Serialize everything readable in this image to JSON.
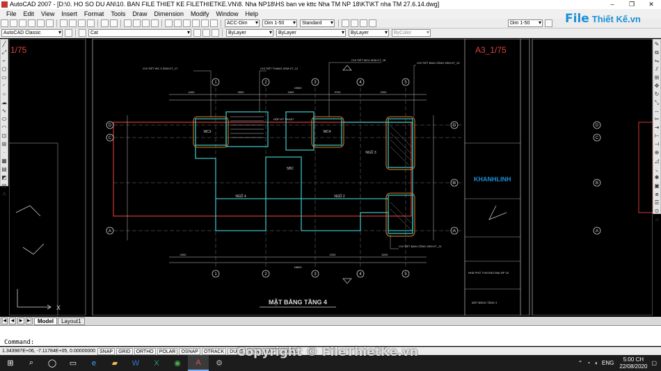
{
  "window": {
    "title": "AutoCAD 2007 - [D:\\0. HO SO DU AN\\10. BAN FILE THIET KE FILETHIETKE.VN\\8. Nha NP18\\HS ban ve kttc Nha TM NP 18\\KT\\KT nha TM 27.6.14.dwg]",
    "minimize": "–",
    "restore": "❐",
    "close": "✕"
  },
  "menu": [
    "File",
    "Edit",
    "View",
    "Insert",
    "Format",
    "Tools",
    "Draw",
    "Dimension",
    "Modify",
    "Window",
    "Help"
  ],
  "brand": {
    "logo": "File",
    "name": "Thiết Kế.vn"
  },
  "toolbar": {
    "text_style": "ACC-Dim",
    "dim_style": "Dim 1-50",
    "table_style": "Standard",
    "dim_style_right": "Dim 1-50",
    "workspace": "AutoCAD Classic",
    "layer": "Cat",
    "color": "ByLayer",
    "linetype": "ByLayer",
    "lineweight": "ByLayer",
    "plotstyle": "ByColor"
  },
  "drawing": {
    "sheet_left_scale": "1/75",
    "sheet_right_scale": "A3_1/75",
    "title": "MẶT BẰNG TẦNG 4",
    "grid_numbers": [
      "1",
      "2",
      "3",
      "4",
      "5"
    ],
    "grid_letters": [
      "D",
      "B",
      "C",
      "B",
      "A"
    ],
    "callouts": [
      "CHI TIẾT WC 3 XEM KT_17",
      "CHI TIẾT THANG XEM KT_12",
      "CHI TIẾT WC4 XEM KT_18",
      "CHI TIẾT BAN CÔNG XEM KT_22",
      "HỘP KỸ THUẬT",
      "CHI TIẾT BAN CÔNG XEM KT_21"
    ],
    "rooms": [
      "WC3",
      "WC4",
      "NGŨ 3",
      "NGŨ 4",
      "NGŨ 2",
      "SBC"
    ],
    "dims": [
      "4400",
      "3500",
      "3400",
      "3700",
      "2900",
      "19500",
      "18600",
      "2000",
      "2200",
      "5200"
    ],
    "title_block_logo": "KHANHLINH",
    "title_block_project": "NHÀ PHỐ THƯƠNG MẠI NP 18",
    "title_block_sheet": "MẶT BẰNG TẦNG 4"
  },
  "tabs": [
    "Model",
    "Layout1"
  ],
  "command": {
    "prompt": "Command:"
  },
  "status": {
    "coords": "1.343987E+06, -7.11784E+05, 0.00000000",
    "buttons": [
      "SNAP",
      "GRID",
      "ORTHO",
      "POLAR",
      "OSNAP",
      "OTRACK",
      "DUCS",
      "DYN",
      "LWT",
      "MODEL"
    ]
  },
  "taskbar": {
    "lang": "ENG",
    "time": "5:00 CH",
    "date": "22/08/2020"
  },
  "watermark": "Copyright © FileThietKe.vn",
  "colors": {
    "cad_bg": "#000000",
    "wall": "#3fbfbf",
    "axis": "#d43a3a",
    "dim": "#e0e0e0",
    "accent": "#1a8fd6"
  }
}
